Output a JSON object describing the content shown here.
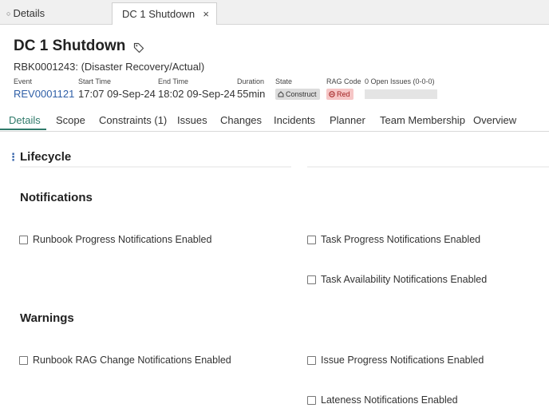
{
  "window_tabs": {
    "details_label": "Details",
    "active_label": "DC 1 Shutdown",
    "close_glyph": "×"
  },
  "header": {
    "title": "DC 1 Shutdown",
    "subtitle": "RBK0001243: (Disaster Recovery/Actual)"
  },
  "meta": {
    "event_label": "Event",
    "event_value": "REV0001121",
    "start_label": "Start Time",
    "start_value": "17:07 09-Sep-24",
    "end_label": "End Time",
    "end_value": "18:02 09-Sep-24",
    "duration_label": "Duration",
    "duration_value": "55min",
    "state_label": "State",
    "state_value": "Construct",
    "rag_label": "RAG Code",
    "rag_value": "Red",
    "issues_label": "0 Open Issues (0-0-0)"
  },
  "nav": {
    "tabs": [
      "Details",
      "Scope",
      "Constraints (1)",
      "Issues",
      "Changes",
      "Incidents",
      "Planner",
      "Team Membership",
      "Overview"
    ]
  },
  "sections": {
    "lifecycle": "Lifecycle",
    "notifications": "Notifications",
    "warnings": "Warnings"
  },
  "notifications": {
    "runbook_progress": "Runbook Progress Notifications Enabled",
    "task_progress": "Task Progress Notifications Enabled",
    "task_availability": "Task Availability Notifications Enabled"
  },
  "warnings": {
    "runbook_rag": "Runbook RAG Change Notifications Enabled",
    "issue_progress": "Issue Progress Notifications Enabled",
    "lateness": "Lateness Notifications Enabled"
  },
  "colors": {
    "accent": "#2f7a6a",
    "link": "#2f5fa7",
    "rag_red_bg": "#f6c6c6"
  },
  "icons": {
    "tag": "tag-icon",
    "state": "construct-icon",
    "rag": "rag-red-icon",
    "menu": "kebab-icon"
  }
}
